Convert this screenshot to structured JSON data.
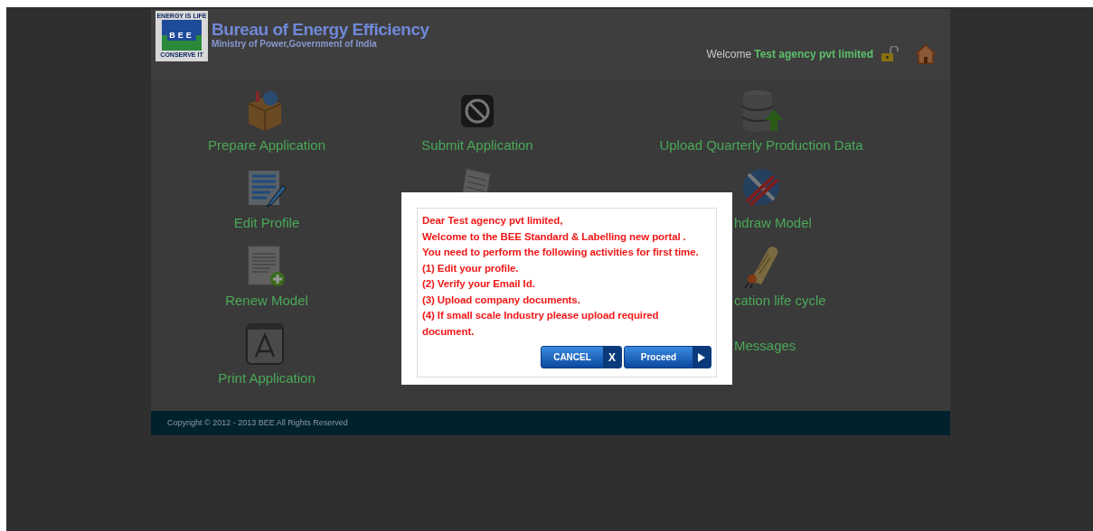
{
  "header": {
    "logo": {
      "top_text": "ENERGY IS LIFE",
      "mid_text": "BEE",
      "bottom_text": "CONSERVE IT"
    },
    "title": "Bureau of Energy Efficiency",
    "subtitle": "Ministry of Power,Government of India",
    "welcome_label": "Welcome",
    "user_name": "Test agency pvt limited"
  },
  "dashboard": {
    "columns": [
      [
        {
          "label": "Prepare Application",
          "kind": "box"
        },
        {
          "label": "Edit Profile",
          "kind": "pencil-doc"
        },
        {
          "label": "Renew Model",
          "kind": "plus-doc"
        },
        {
          "label": "Print Application",
          "kind": "app-a"
        }
      ],
      [
        {
          "label": "Submit Application",
          "kind": "no-entry"
        },
        {
          "kind": "sheet"
        }
      ],
      [
        {
          "label": "Upload Quarterly Production Data",
          "kind": "database",
          "label_cut": false
        },
        {
          "label": "hdraw Model",
          "kind": "globe-tools",
          "label_cut": true
        },
        {
          "label": "cation life cycle",
          "kind": "scroll",
          "label_cut": true
        },
        {
          "label": "Messages",
          "kind": "text-only",
          "label_cut": true
        }
      ]
    ]
  },
  "footer": {
    "copyright": "Copyright © 2012 - 2013 BEE All Rights Reserved"
  },
  "modal": {
    "lines": [
      "Dear Test agency pvt limited,",
      "Welcome to the BEE Standard & Labelling new portal .",
      "You need to perform the following activities for first time.",
      "(1) Edit your profile.",
      "(2) Verify your Email Id.",
      "(3) Upload company documents.",
      "(4) If small scale Industry please upload required document."
    ],
    "buttons": [
      {
        "label": "CANCEL",
        "kind": "cancel",
        "glyph": "X"
      },
      {
        "label": "Proceed",
        "kind": "proceed"
      }
    ]
  }
}
